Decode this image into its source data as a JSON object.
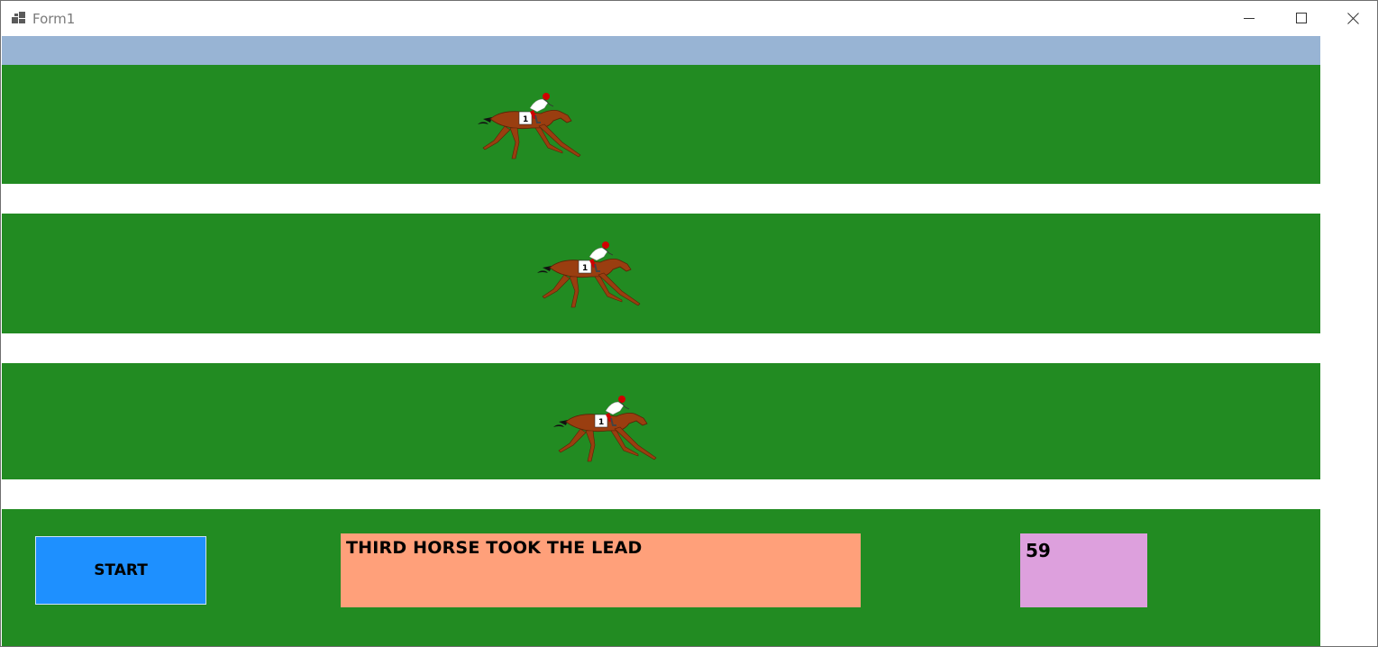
{
  "window": {
    "title": "Form1",
    "icon": "form-app-icon",
    "controls": [
      "minimize-icon",
      "maximize-icon",
      "close-icon"
    ]
  },
  "colors": {
    "track_green": "#228b22",
    "top_strip": "#98b4d4",
    "start_button": "#1e90ff",
    "status_box": "#ffa07a",
    "counter_box": "#dda0dd"
  },
  "race": {
    "lanes": [
      {
        "name": "lane-1",
        "horse_number": "1"
      },
      {
        "name": "lane-2",
        "horse_number": "1"
      },
      {
        "name": "lane-3",
        "horse_number": "1"
      }
    ]
  },
  "controls": {
    "start_label": "START",
    "status_message": "THIRD HORSE TOOK THE LEAD",
    "counter_value": "59"
  }
}
